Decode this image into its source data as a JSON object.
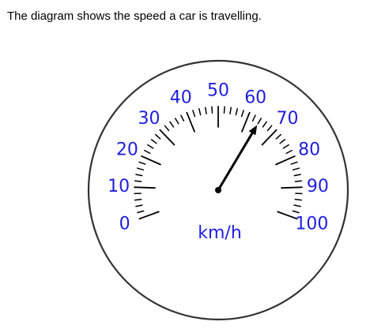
{
  "question": {
    "text": "The diagram shows the speed a car is travelling."
  },
  "gauge": {
    "unit_label": "km/h",
    "scale_labels": [
      "0",
      "10",
      "20",
      "30",
      "40",
      "50",
      "60",
      "70",
      "80",
      "90",
      "100"
    ],
    "min_value": 0,
    "max_value": 100,
    "minor_step": 2,
    "needle_value": 64,
    "colors": {
      "dial_outline": "#333333",
      "tick": "#000000",
      "label": "#1f1fe0",
      "needle": "#000000"
    }
  }
}
